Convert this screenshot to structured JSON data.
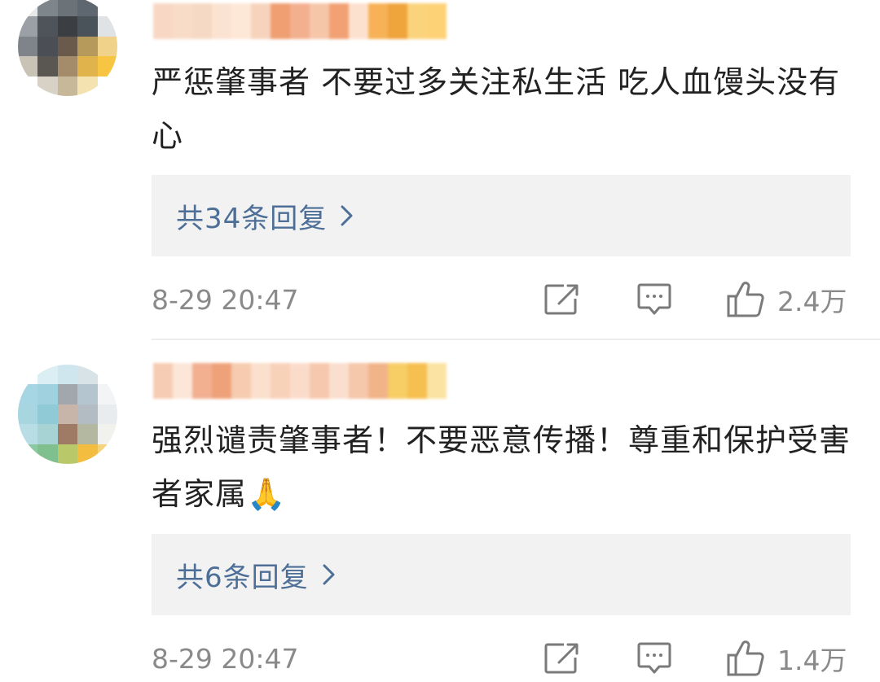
{
  "comments": [
    {
      "text": "严惩肇事者 不要过多关注私生活 吃人血馒头没有心",
      "replies_label": "共34条回复",
      "time": "8-29 20:47",
      "likes": "2.4万",
      "avatar_colors": [
        "#e8e8e8",
        "#7e858b",
        "#6b7278",
        "#5e6670",
        "#ffffff",
        "#9aa0a5",
        "#4e545a",
        "#3b3f44",
        "#4a525a",
        "#dfe3e6",
        "#7e8489",
        "#4b4f55",
        "#6a5a4c",
        "#b59a5c",
        "#f1d28b",
        "#c9c3b6",
        "#5a5652",
        "#a48b6a",
        "#e0b34d",
        "#f7c542",
        "#ffffff",
        "#d8d2c6",
        "#c8b89a",
        "#f4e3b0",
        "#ffffff"
      ],
      "username_colors": [
        "#f9d7c5",
        "#f8dcc8",
        "#f6d9c4",
        "#fbe3d2",
        "#fde8d8",
        "#f7d3bd",
        "#ef9f72",
        "#f3b08f",
        "#f6c6a9",
        "#f2a174",
        "#fde1cf",
        "#f7b257",
        "#f0a43c",
        "#fbd37c",
        "#fdd277"
      ]
    },
    {
      "text": "强烈谴责肇事者！不要恶意传播！尊重和保护受害者家属🙏",
      "replies_label": "共6条回复",
      "time": "8-29 20:47",
      "likes": "1.4万",
      "avatar_colors": [
        "#ffffff",
        "#dbeef4",
        "#cfe6ee",
        "#d8e3e8",
        "#ffffff",
        "#a6d6e4",
        "#9fd1de",
        "#a2a7ad",
        "#b4c5cf",
        "#f2f4f6",
        "#a7d5e0",
        "#8fcad6",
        "#c6b5a8",
        "#b2bcc2",
        "#e8ecef",
        "#b9dde4",
        "#a7d3d4",
        "#9f7a64",
        "#b4b8a0",
        "#f1f1ee",
        "#8cc8a4",
        "#7fc08e",
        "#b9c96a",
        "#f3be3f",
        "#f7d37a"
      ],
      "username_colors": [
        "#f7ccb4",
        "#fbe6d8",
        "#f2b091",
        "#efa27a",
        "#f6cbb0",
        "#fae0cd",
        "#f8d1b9",
        "#fbdccb",
        "#f6c8ae",
        "#fadfcf",
        "#f5c7ab",
        "#f1b489",
        "#f7cd66",
        "#f5c04f",
        "#fbe3a3"
      ]
    }
  ],
  "icons": {
    "share": "share-icon",
    "comment": "comment-icon",
    "like": "thumbs-up-icon",
    "chevron": "chevron-right-icon"
  }
}
